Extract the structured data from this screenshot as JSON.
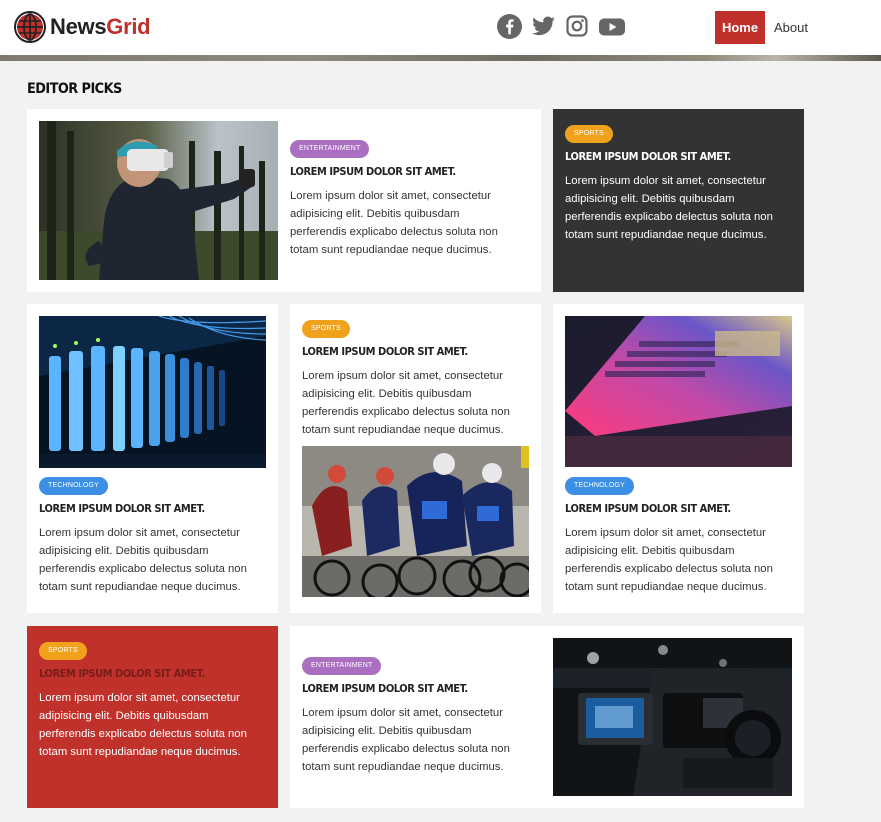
{
  "brand": {
    "name_part1": "News",
    "name_part2": "Grid"
  },
  "social": [
    "facebook-icon",
    "twitter-icon",
    "instagram-icon",
    "youtube-icon"
  ],
  "nav": {
    "home": "Home",
    "about": "About"
  },
  "section_title": "EDITOR PICKS",
  "colors": {
    "accent": "#c0312b",
    "entertainment": "#aa6fc0",
    "sports": "#f0a21d",
    "technology": "#3d8fe6",
    "dark_card": "#333333"
  },
  "cards": [
    {
      "category": "ENTERTAINMENT",
      "title": "LOREM IPSUM DOLOR SIT AMET.",
      "body": "Lorem ipsum dolor sit amet, consectetur adipisicing elit. Debitis quibusdam perferendis explicabo delectus soluta non totam sunt repudiandae neque ducimus."
    },
    {
      "category": "SPORTS",
      "title": "LOREM IPSUM DOLOR SIT AMET.",
      "body": "Lorem ipsum dolor sit amet, consectetur adipisicing elit. Debitis quibusdam perferendis explicabo delectus soluta non totam sunt repudiandae neque ducimus."
    },
    {
      "category": "TECHNOLOGY",
      "title": "LOREM IPSUM DOLOR SIT AMET.",
      "body": "Lorem ipsum dolor sit amet, consectetur adipisicing elit. Debitis quibusdam perferendis explicabo delectus soluta non totam sunt repudiandae neque ducimus."
    },
    {
      "category": "SPORTS",
      "title": "LOREM IPSUM DOLOR SIT AMET.",
      "body": "Lorem ipsum dolor sit amet, consectetur adipisicing elit. Debitis quibusdam perferendis explicabo delectus soluta non totam sunt repudiandae neque ducimus."
    },
    {
      "category": "TECHNOLOGY",
      "title": "LOREM IPSUM DOLOR SIT AMET.",
      "body": "Lorem ipsum dolor sit amet, consectetur adipisicing elit. Debitis quibusdam perferendis explicabo delectus soluta non totam sunt repudiandae neque ducimus."
    },
    {
      "category": "SPORTS",
      "title": "LOREM IPSUM DOLOR SIT AMET.",
      "body": "Lorem ipsum dolor sit amet, consectetur adipisicing elit. Debitis quibusdam perferendis explicabo delectus soluta non totam sunt repudiandae neque ducimus."
    },
    {
      "category": "ENTERTAINMENT",
      "title": "LOREM IPSUM DOLOR SIT AMET.",
      "body": "Lorem ipsum dolor sit amet, consectetur adipisicing elit. Debitis quibusdam perferendis explicabo delectus soluta non totam sunt repudiandae neque ducimus."
    }
  ]
}
